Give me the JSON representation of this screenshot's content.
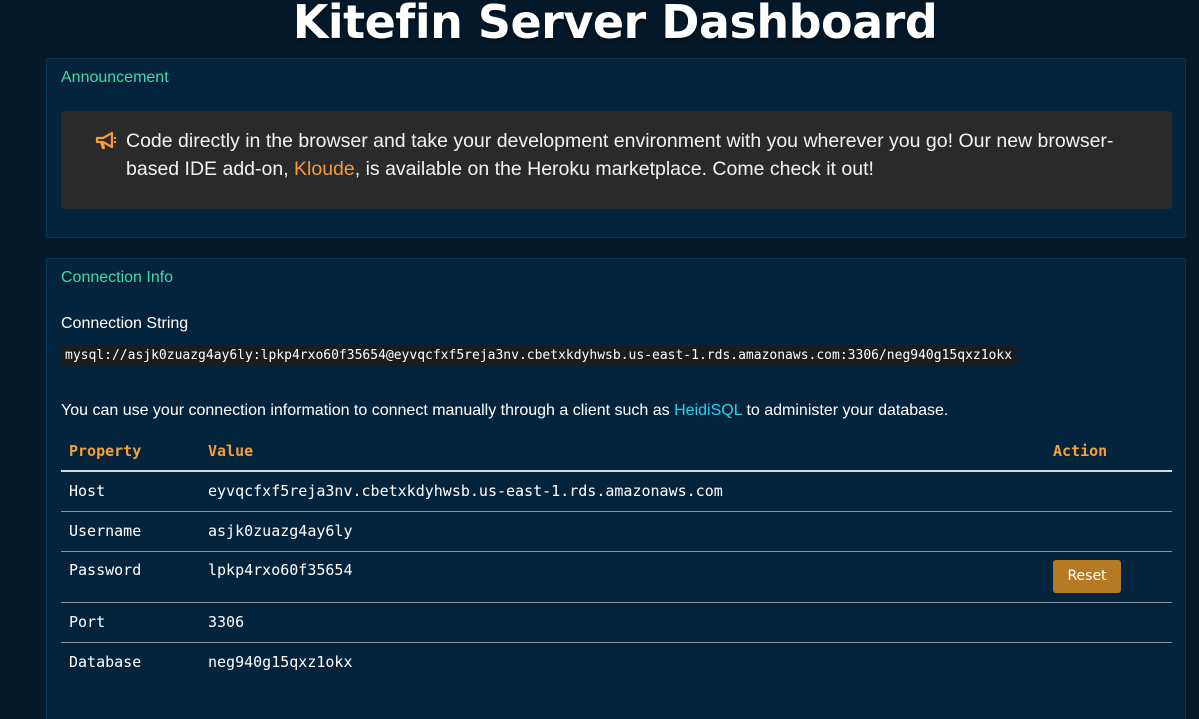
{
  "page": {
    "title": "Kitefin Server Dashboard"
  },
  "announcement": {
    "header": "Announcement",
    "text_before": "Code directly in the browser and take your development environment with you wherever you go! Our new browser-based IDE add-on, ",
    "link_label": "Kloude",
    "text_after": ", is available on the Heroku marketplace. Come check it out!",
    "icon": "megaphone-icon",
    "accent_color": "#f5993a"
  },
  "connection": {
    "header": "Connection Info",
    "string_label": "Connection String",
    "string_value": "mysql://asjk0zuazg4ay6ly:lpkp4rxo60f35654@eyvqcfxf5reja3nv.cbetxkdyhwsb.us-east-1.rds.amazonaws.com:3306/neg940g15qxz1okx",
    "info_before": "You can use your connection information to connect manually through a client such as ",
    "info_link": "HeidiSQL",
    "info_after": " to administer your database.",
    "table": {
      "headers": [
        "Property",
        "Value",
        "Action"
      ],
      "rows": [
        {
          "property": "Host",
          "value": "eyvqcfxf5reja3nv.cbetxkdyhwsb.us-east-1.rds.amazonaws.com"
        },
        {
          "property": "Username",
          "value": "asjk0zuazg4ay6ly"
        },
        {
          "property": "Password",
          "value": "lpkp4rxo60f35654",
          "action": "Reset"
        },
        {
          "property": "Port",
          "value": "3306"
        },
        {
          "property": "Database",
          "value": "neg940g15qxz1okx"
        }
      ]
    }
  },
  "colors": {
    "background": "#03192a",
    "card": "#04243e",
    "card_header": "#3ddba6",
    "table_header": "#f5a13a",
    "link": "#22d3ee",
    "reset_button": "#b57a23"
  }
}
